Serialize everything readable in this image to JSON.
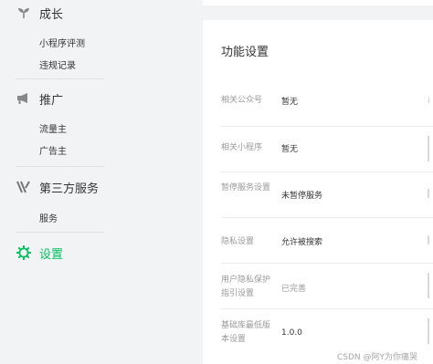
{
  "sidebar": {
    "groups": [
      {
        "title": "成长",
        "icon": "sprout-icon",
        "items": [
          "小程序评测",
          "违规记录"
        ]
      },
      {
        "title": "推广",
        "icon": "megaphone-icon",
        "items": [
          "流量主",
          "广告主"
        ]
      },
      {
        "title": "第三方服务",
        "icon": "third-party-icon",
        "items": [
          "服务"
        ]
      }
    ],
    "active": {
      "title": "设置",
      "icon": "gear-icon",
      "color": "#07c160"
    }
  },
  "panel": {
    "title": "功能设置",
    "rows": [
      {
        "label": "相关公众号",
        "value": "暂无",
        "extra": "i"
      },
      {
        "label": "相关小程序",
        "value": "暂无",
        "extra": ""
      },
      {
        "label": "暂停服务设置",
        "value": "未暂停服务",
        "extra": ""
      },
      {
        "label": "隐私设置",
        "value": "允许被搜索",
        "extra": ""
      },
      {
        "label": "用户隐私保护指引设置",
        "value": "已完善",
        "extra": ""
      },
      {
        "label": "基础库最低版本设置",
        "value": "1.0.0",
        "extra": ""
      }
    ]
  },
  "watermark": "CSDN @阿Y为你痛哭"
}
